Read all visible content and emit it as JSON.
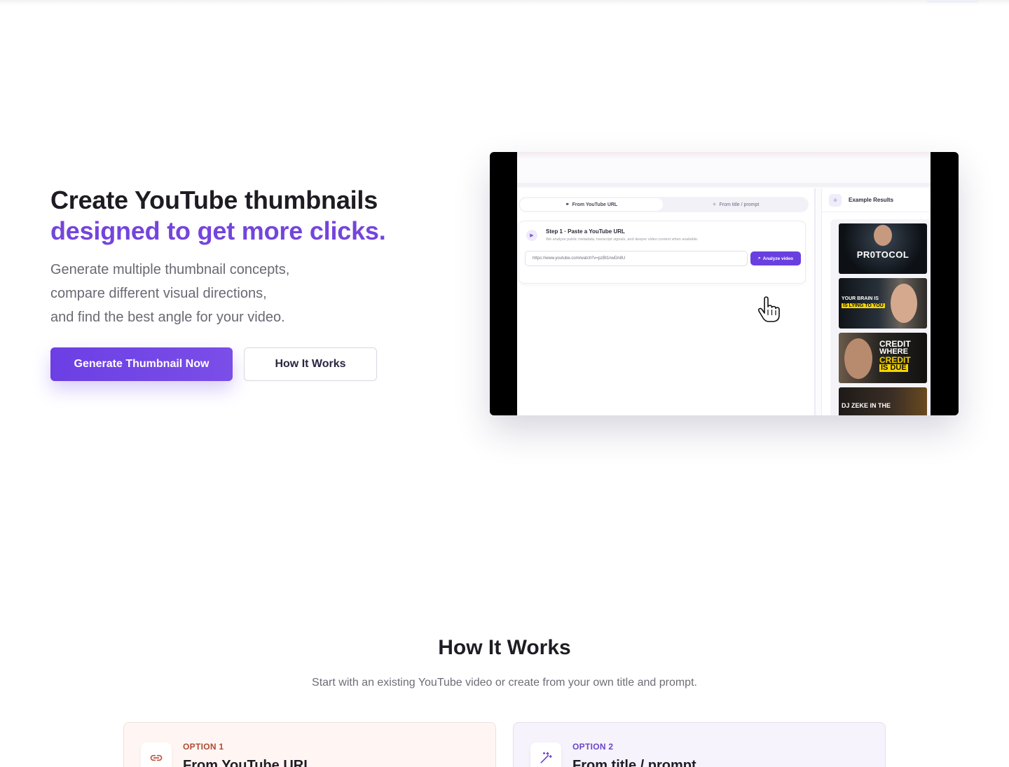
{
  "hero": {
    "title_line1": "Create YouTube thumbnails",
    "title_line2": "designed to get more clicks.",
    "subtitle_lines": [
      "Generate multiple thumbnail concepts,",
      "compare different visual directions,",
      "and find the best angle for your video."
    ],
    "primary_button": "Generate Thumbnail Now",
    "secondary_button": "How It Works"
  },
  "preview": {
    "tab_active": "From YouTube URL",
    "tab_inactive": "From title / prompt",
    "step_title": "Step 1 · Paste a YouTube URL",
    "step_desc": "We analyze public metadata, transcript signals, and deeper video context when available.",
    "url_value": "https://www.youtube.com/watch?v=pzBt1nwDn8U",
    "analyze_button": "Analyze video",
    "side_title": "Example Results",
    "thumbnails": {
      "t1": "PR0TOCOL",
      "t2_line1": "YOUR BRAIN IS",
      "t2_line2": "IS LYING TO YOU",
      "t3_line1": "CREDIT",
      "t3_line2": "WHERE",
      "t3_line3": "CREDIT",
      "t3_line4": "IS DUE",
      "t4": "DJ ZEKE IN THE"
    }
  },
  "how_it_works": {
    "title": "How It Works",
    "subtitle": "Start with an existing YouTube video or create from your own title and prompt.",
    "options": [
      {
        "label": "OPTION 1",
        "title": "From YouTube URL",
        "icon": "link-icon"
      },
      {
        "label": "OPTION 2",
        "title": "From title / prompt",
        "icon": "magic-wand-icon"
      }
    ]
  },
  "colors": {
    "accent": "#7445dc",
    "primary_button": "#6b3fe4",
    "option1_tint": "#fff6f4",
    "option2_tint": "#f6f3fd"
  }
}
